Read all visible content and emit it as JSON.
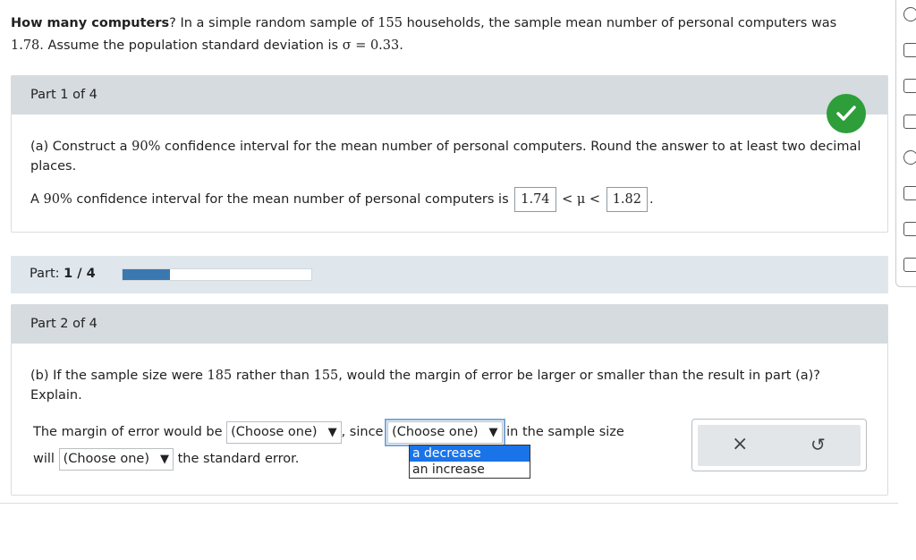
{
  "problem": {
    "title": "How many computers",
    "text_a": "? In a simple random sample of ",
    "n": "155",
    "text_b": " households, the sample mean number of personal computers was ",
    "mean": "1.78",
    "text_c": ". Assume the population standard deviation is ",
    "sigma": "σ = 0.33",
    "text_d": "."
  },
  "part1": {
    "header": "Part 1 of 4",
    "q_a": "(a) Construct a ",
    "q_pct": "90%",
    "q_b": " confidence interval for the mean number of personal computers. Round the answer to at least two decimal places.",
    "ans_a": "A ",
    "ans_pct": "90%",
    "ans_b": " confidence interval for the mean number of personal computers is",
    "lower": "1.74",
    "ineq": "< μ <",
    "upper": "1.82",
    "end": "."
  },
  "progress": {
    "label": "Part:",
    "value": "1 / 4",
    "fraction": 0.25
  },
  "part2": {
    "header": "Part 2 of 4",
    "q_a": "(b) If the sample size were ",
    "n_new": "185",
    "q_b": " rather than ",
    "n_old": "155",
    "q_c": ", would the margin of error be larger or smaller than the result in part (a)? Explain.",
    "s1": "The margin of error would be",
    "sel1": "(Choose one)",
    "comma_since": ", since",
    "sel2": "(Choose one)",
    "s2": "in the sample size",
    "s3": "will",
    "sel3": "(Choose one)",
    "s4": "the standard error.",
    "options": [
      "a decrease",
      "an increase"
    ]
  },
  "tools": {
    "clear": "×",
    "undo": "↺"
  }
}
